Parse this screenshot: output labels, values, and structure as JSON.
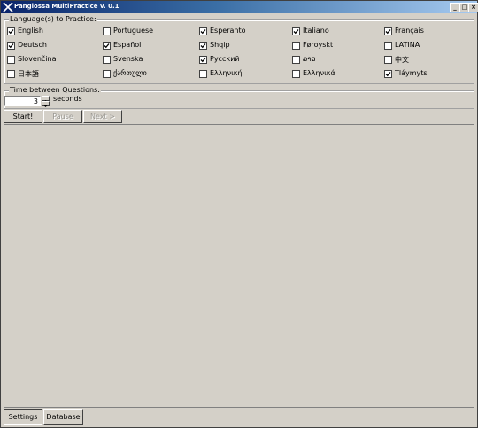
{
  "window": {
    "title": "Panglossa MultiPractice v. 0.1",
    "controls": {
      "minimize": "_",
      "maximize": "□",
      "close": "×"
    }
  },
  "languages_group": {
    "legend": "Language(s) to Practice:",
    "items": [
      {
        "label": "English",
        "checked": true
      },
      {
        "label": "Portuguese",
        "checked": false
      },
      {
        "label": "Esperanto",
        "checked": true
      },
      {
        "label": "Italiano",
        "checked": true
      },
      {
        "label": "Français",
        "checked": true
      },
      {
        "label": "Deutsch",
        "checked": true
      },
      {
        "label": "Español",
        "checked": true
      },
      {
        "label": "Shqip",
        "checked": true
      },
      {
        "label": "Føroyskt",
        "checked": false
      },
      {
        "label": "LATINA",
        "checked": false
      },
      {
        "label": "Slovenčina",
        "checked": false
      },
      {
        "label": "Svenska",
        "checked": false
      },
      {
        "label": "Русский",
        "checked": true
      },
      {
        "label": "ລາວ",
        "checked": false
      },
      {
        "label": "中文",
        "checked": false
      },
      {
        "label": "日本語",
        "checked": false
      },
      {
        "label": "ქართული",
        "checked": false
      },
      {
        "label": "Ελληνική",
        "checked": false
      },
      {
        "label": "Ελληνικά",
        "checked": false
      },
      {
        "label": "Tláymyts",
        "checked": true
      }
    ]
  },
  "timer_group": {
    "legend": "Time between Questions:",
    "value": "3",
    "unit": "seconds"
  },
  "controls": {
    "start": "Start!",
    "pause": "Pause",
    "next": "Next >"
  },
  "bottom_tabs": {
    "settings": "Settings",
    "database": "Database"
  },
  "colors": {
    "face": "#d4d0c8",
    "titlebar_start": "#0a246a",
    "titlebar_end": "#a6caf0"
  }
}
